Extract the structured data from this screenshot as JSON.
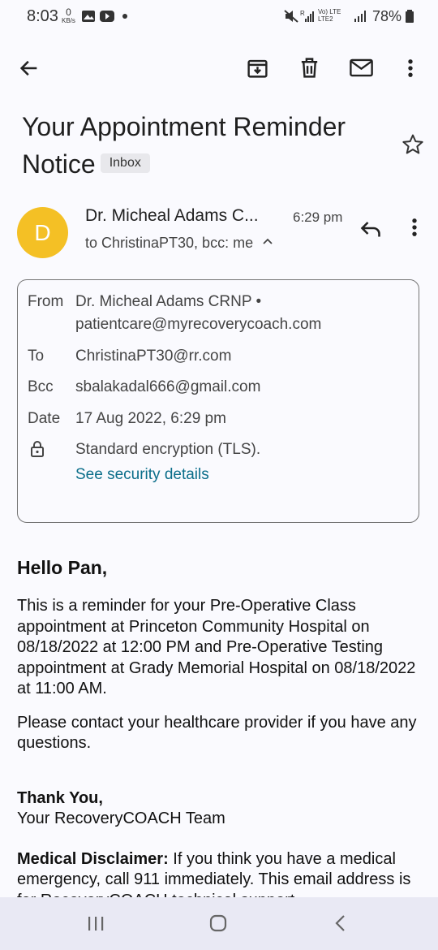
{
  "status_bar": {
    "time": "8:03",
    "data_rate_value": "0",
    "data_rate_unit": "KB/s",
    "network_label_1": "Vo) LTE",
    "network_label_2": "LTE2",
    "battery": "78%"
  },
  "toolbar": {
    "icons": [
      "back-arrow-icon",
      "archive-icon",
      "delete-icon",
      "mark-unread-icon",
      "more-vert-icon"
    ]
  },
  "email": {
    "subject_line1": "Your Appointment Reminder",
    "subject_line2": "Notice",
    "label": "Inbox",
    "avatar_letter": "D",
    "avatar_color": "#f4c025",
    "sender_name": "Dr. Micheal Adams C...",
    "time": "6:29 pm",
    "recipients": "to ChristinaPT30, bcc: me",
    "details": {
      "from_label": "From",
      "from_name": "Dr. Micheal Adams CRNP •",
      "from_email": "patientcare@myrecoverycoach.com",
      "to_label": "To",
      "to_value": "ChristinaPT30@rr.com",
      "bcc_label": "Bcc",
      "bcc_value": "sbalakadal666@gmail.com",
      "date_label": "Date",
      "date_value": "17 Aug 2022, 6:29 pm",
      "encryption": "Standard encryption (TLS).",
      "security_link": "See security details"
    },
    "body": {
      "greeting": "Hello Pan,",
      "paragraph1": "This is a reminder for your Pre-Operative Class appointment at Princeton Community Hospital on 08/18/2022 at 12:00 PM and Pre-Operative Testing appointment at Grady Memorial Hospital on 08/18/2022 at 11:00 AM.",
      "paragraph2": "Please contact your healthcare provider if you have any questions.",
      "thanks": "Thank You,",
      "team": "Your RecoveryCOACH Team",
      "disclaimer_label": "Medical Disclaimer:",
      "disclaimer_text": " If you think you have a medical emergency, call 911 immediately. This email address is for RecoveryCOACH technical support"
    }
  },
  "navbar": {
    "icons": [
      "recent-apps-icon",
      "home-icon",
      "back-icon"
    ]
  }
}
